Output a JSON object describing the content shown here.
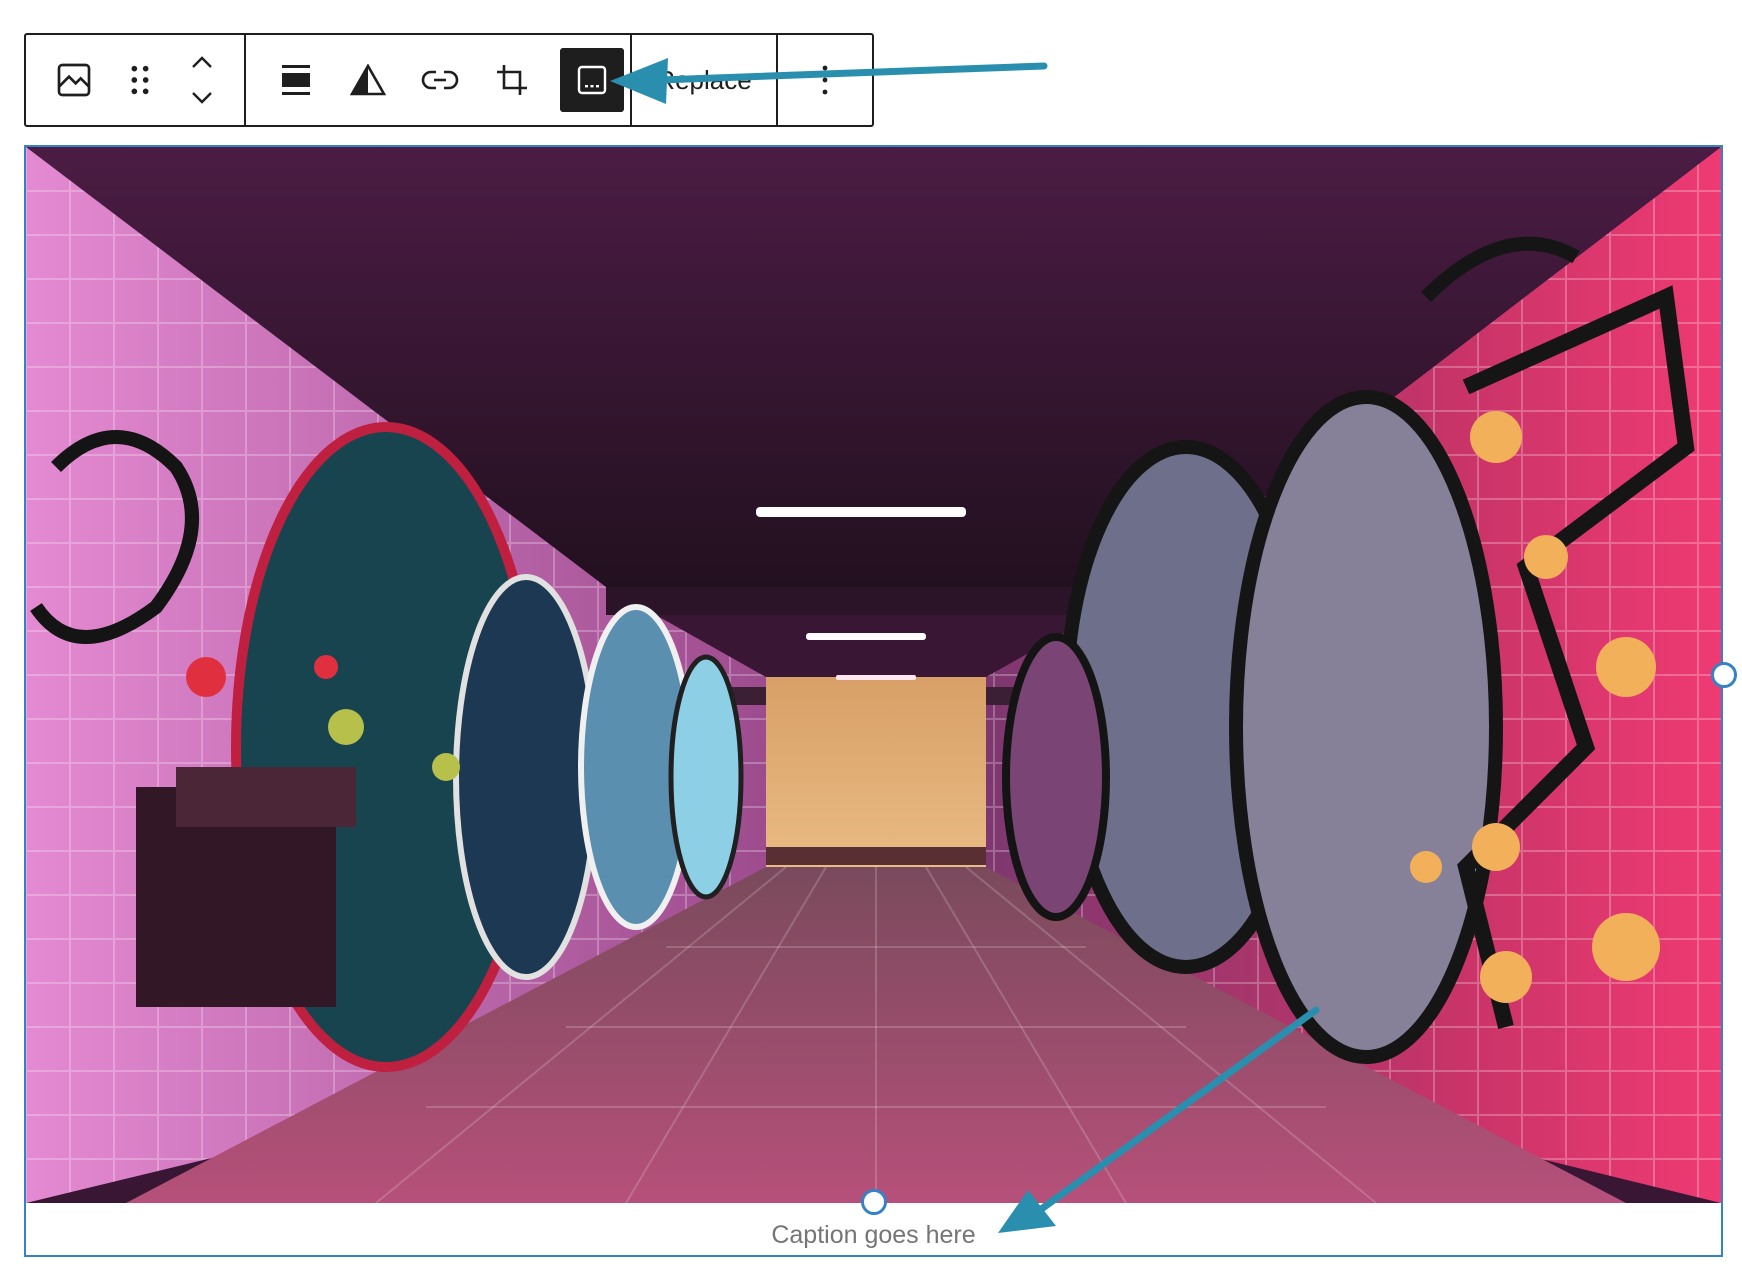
{
  "toolbar": {
    "block_type_icon": "image-icon",
    "drag_icon": "drag-handle-icon",
    "move_up_icon": "chevron-up-icon",
    "move_down_icon": "chevron-down-icon",
    "align_icon": "align-center-icon",
    "duotone_icon": "duotone-icon",
    "link_icon": "link-icon",
    "crop_icon": "crop-icon",
    "caption_icon": "caption-icon",
    "caption_toggle_active": true,
    "replace_label": "Replace",
    "more_icon": "more-vertical-icon"
  },
  "image": {
    "description_icon": "image-content"
  },
  "caption": {
    "text": "Caption goes here"
  },
  "colors": {
    "toolbar_border": "#1e1e1e",
    "active_button": "#1e1e1e",
    "selection_blue": "#3582c4",
    "arrow_teal": "#2a8fae",
    "caption_text": "#757575"
  }
}
